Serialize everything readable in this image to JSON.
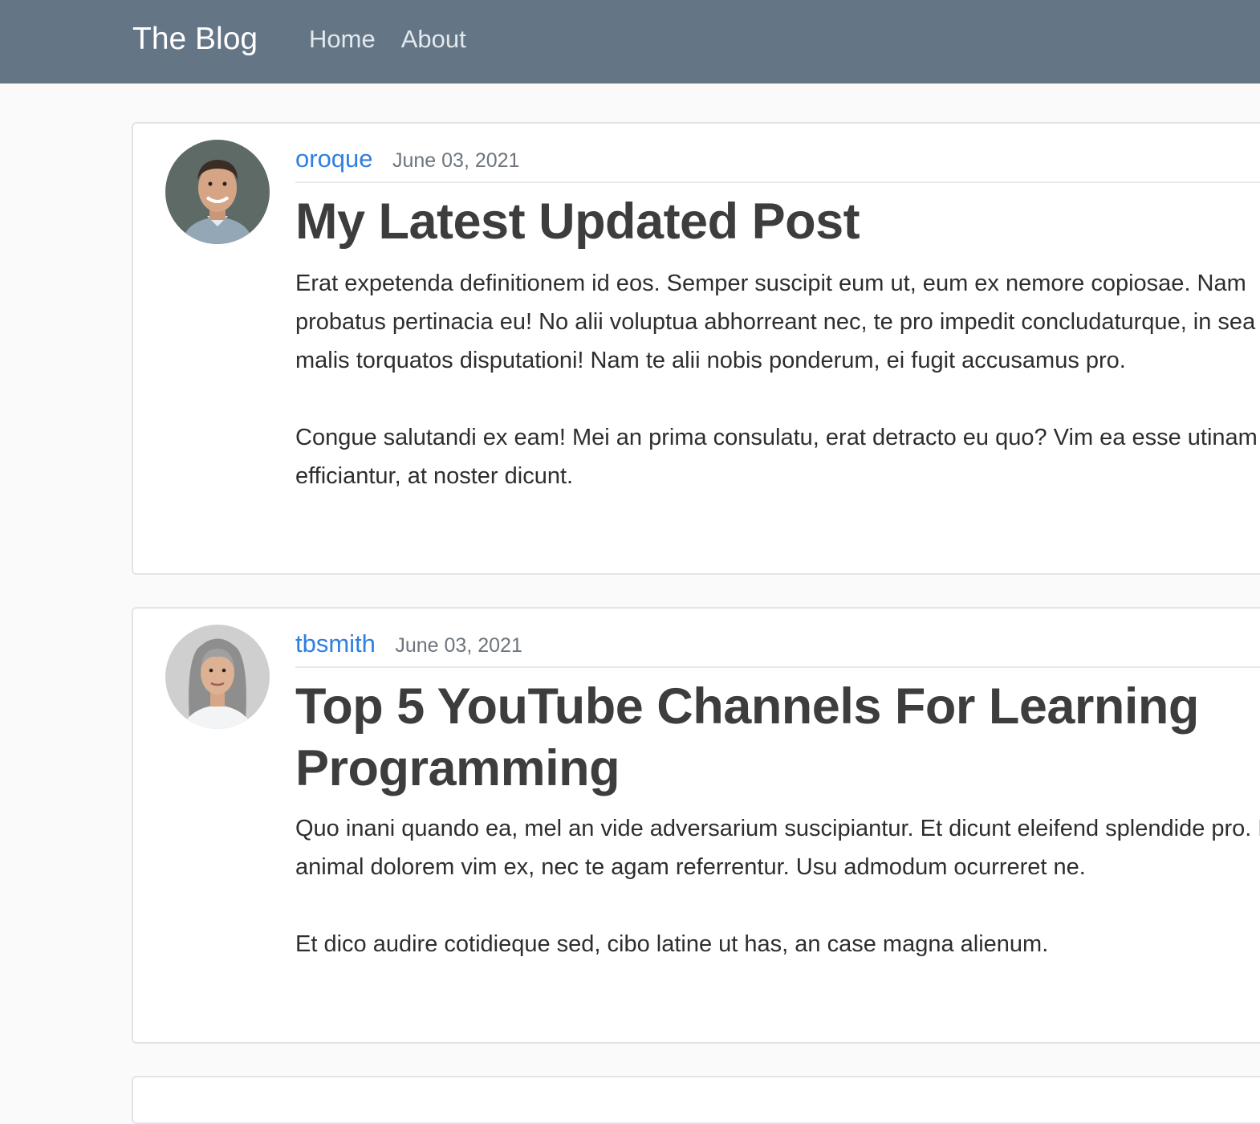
{
  "navbar": {
    "brand": "The Blog",
    "links": [
      {
        "label": "Home"
      },
      {
        "label": "About"
      }
    ]
  },
  "posts": [
    {
      "author": "oroque",
      "date": "June 03, 2021",
      "title": "My Latest Updated Post",
      "content": "Erat expetenda definitionem id eos. Semper suscipit eum ut, eum ex nemore copiosae. Nam probatus pertinacia eu! No alii voluptua abhorreant nec, te pro impedit concludaturque, in sea malis torquatos disputationi! Nam te alii nobis ponderum, ei fugit accusamus pro.\n\nCongue salutandi ex eam! Mei an prima consulatu, erat detracto eu quo? Vim ea esse utinam efficiantur, at noster dicunt."
    },
    {
      "author": "tbsmith",
      "date": "June 03, 2021",
      "title": "Top 5 YouTube Channels For Learning Programming",
      "content": "Quo inani quando ea, mel an vide adversarium suscipiantur. Et dicunt eleifend splendide pro. Nibh animal dolorem vim ex, nec te agam referrentur. Usu admodum ocurreret ne.\n\nEt dico audire cotidieque sed, cibo latine ut has, an case magna alienum."
    }
  ],
  "colors": {
    "navbar": "#647686",
    "link": "#2f7fe0",
    "page_bg": "#fafafa"
  }
}
